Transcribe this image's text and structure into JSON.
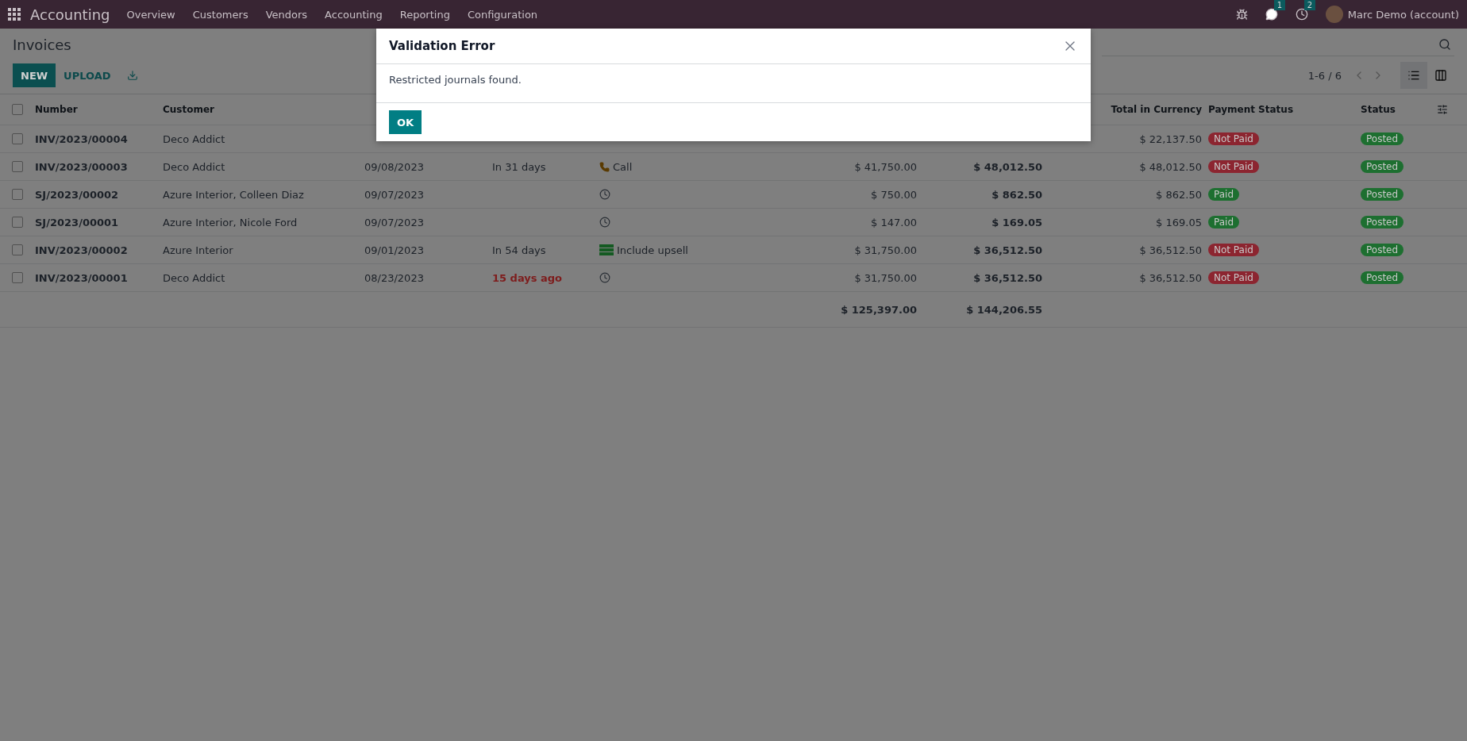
{
  "navbar": {
    "app_name": "Accounting",
    "menu": [
      "Overview",
      "Customers",
      "Vendors",
      "Accounting",
      "Reporting",
      "Configuration"
    ],
    "messages_count": "1",
    "activities_count": "2",
    "user": "Marc Demo (account)"
  },
  "breadcrumb": "Invoices",
  "toolbar": {
    "new": "NEW",
    "upload": "UPLOAD",
    "pager": "1-6 / 6",
    "views": [
      {
        "kind": "list",
        "selected": true
      },
      {
        "kind": "kanban",
        "selected": false
      }
    ]
  },
  "table": {
    "header": {
      "checked": false,
      "number": "Number",
      "customer": "Customer",
      "total_in_currency": "Total in Currency",
      "payment_status": "Payment Status",
      "status": "Status"
    },
    "rows": [
      {
        "checked": false,
        "number": "INV/2023/00004",
        "customer": "Deco Addict",
        "total_in_currency": "$ 22,137.50",
        "payment_status": {
          "label": "Not Paid",
          "color": "#8c2530"
        },
        "status": {
          "label": "Posted",
          "color": "#1d6f30"
        }
      },
      {
        "checked": false,
        "number": "INV/2023/00003",
        "customer": "Deco Addict",
        "invoice_date": "09/08/2023",
        "due_date": {
          "text": "In 31 days",
          "overdue": false
        },
        "activity": {
          "kind": "call",
          "label": "Call"
        },
        "untaxed": "$ 41,750.00",
        "total": "$ 48,012.50",
        "total_in_currency": "$ 48,012.50",
        "payment_status": {
          "label": "Not Paid",
          "color": "#8c2530"
        },
        "status": {
          "label": "Posted",
          "color": "#1d6f30"
        }
      },
      {
        "checked": false,
        "number": "SJ/2023/00002",
        "customer": "Azure Interior, Colleen Diaz",
        "invoice_date": "09/07/2023",
        "activity": {
          "kind": "clock"
        },
        "untaxed": "$ 750.00",
        "total": "$ 862.50",
        "total_in_currency": "$ 862.50",
        "payment_status": {
          "label": "Paid",
          "color": "#1d6f30"
        },
        "status": {
          "label": "Posted",
          "color": "#1d6f30"
        }
      },
      {
        "checked": false,
        "number": "SJ/2023/00001",
        "customer": "Azure Interior, Nicole Ford",
        "invoice_date": "09/07/2023",
        "activity": {
          "kind": "clock"
        },
        "untaxed": "$ 147.00",
        "total": "$ 169.05",
        "total_in_currency": "$ 169.05",
        "payment_status": {
          "label": "Paid",
          "color": "#1d6f30"
        },
        "status": {
          "label": "Posted",
          "color": "#1d6f30"
        }
      },
      {
        "checked": false,
        "number": "INV/2023/00002",
        "customer": "Azure Interior",
        "invoice_date": "09/01/2023",
        "due_date": {
          "text": "In 54 days",
          "overdue": false
        },
        "activity": {
          "kind": "upsell",
          "label": "Include upsell"
        },
        "untaxed": "$ 31,750.00",
        "total": "$ 36,512.50",
        "total_in_currency": "$ 36,512.50",
        "payment_status": {
          "label": "Not Paid",
          "color": "#8c2530"
        },
        "status": {
          "label": "Posted",
          "color": "#1d6f30"
        }
      },
      {
        "checked": false,
        "number": "INV/2023/00001",
        "customer": "Deco Addict",
        "invoice_date": "08/23/2023",
        "due_date": {
          "text": "15 days ago",
          "overdue": true
        },
        "activity": {
          "kind": "clock"
        },
        "untaxed": "$ 31,750.00",
        "total": "$ 36,512.50",
        "total_in_currency": "$ 36,512.50",
        "payment_status": {
          "label": "Not Paid",
          "color": "#8c2530"
        },
        "status": {
          "label": "Posted",
          "color": "#1d6f30"
        }
      }
    ],
    "totals": {
      "untaxed": "$ 125,397.00",
      "total": "$ 144,206.55"
    }
  },
  "dialog": {
    "title": "Validation Error",
    "message": "Restricted journals found.",
    "button": "OK"
  }
}
